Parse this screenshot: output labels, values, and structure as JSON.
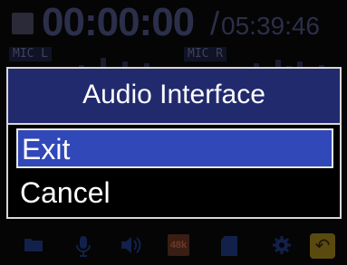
{
  "recorder": {
    "elapsed_time": "00:00:00",
    "slash": "/",
    "remaining_time": "05:39:46",
    "meter_left_label": "MIC L",
    "meter_right_label": "MIC R"
  },
  "icons": {
    "folder": "folder-icon",
    "mic": "microphone-icon",
    "speaker": "speaker-icon",
    "sample_rate": "48k",
    "sd_card": "sd-card-icon",
    "settings": "gear-icon",
    "back": "back-icon"
  },
  "dialog": {
    "title": "Audio Interface",
    "options": [
      {
        "label": "Exit",
        "selected": true
      },
      {
        "label": "Cancel",
        "selected": false
      }
    ]
  },
  "colors": {
    "title_bar": "#222a6e",
    "selection": "#3148b8",
    "border": "#d8d8d8"
  }
}
